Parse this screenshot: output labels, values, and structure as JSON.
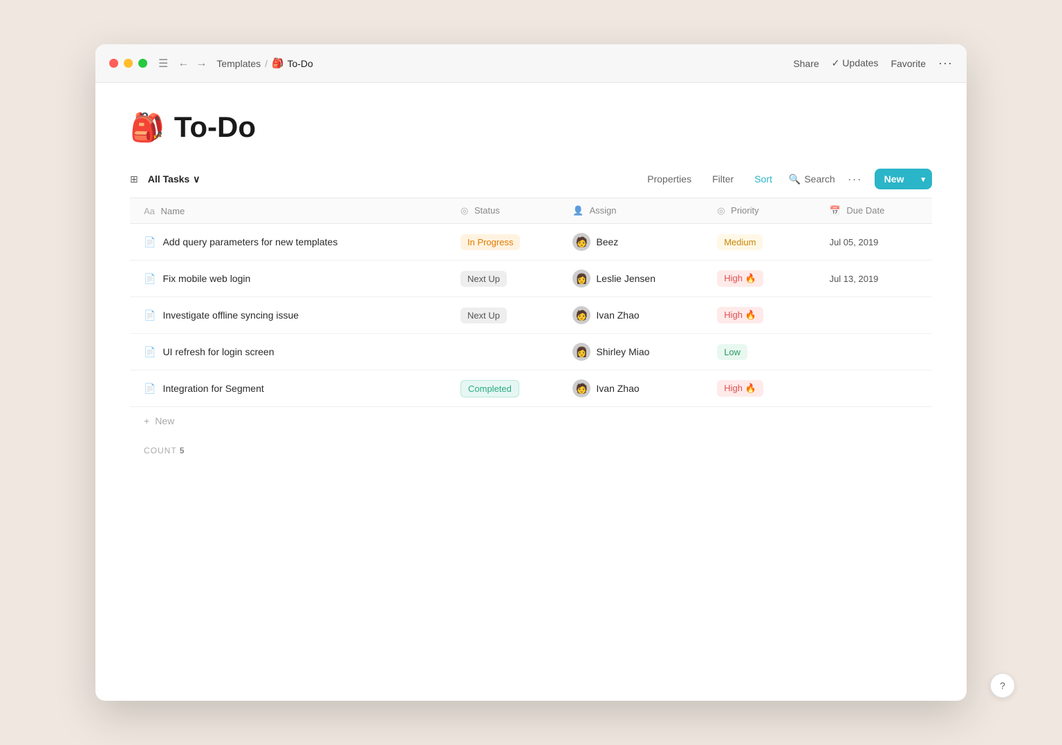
{
  "window": {
    "title": "To-Do",
    "breadcrumb_parent": "Templates",
    "breadcrumb_separator": "/",
    "breadcrumb_icon": "🎒",
    "breadcrumb_current": "To-Do"
  },
  "titlebar": {
    "share_label": "Share",
    "updates_label": "✓ Updates",
    "favorite_label": "Favorite",
    "more_label": "···"
  },
  "page": {
    "icon": "🎒",
    "title": "To-Do"
  },
  "toolbar": {
    "all_tasks_label": "All Tasks",
    "properties_label": "Properties",
    "filter_label": "Filter",
    "sort_label": "Sort",
    "search_label": "Search",
    "new_label": "New"
  },
  "columns": {
    "name": "Name",
    "status": "Status",
    "assign": "Assign",
    "priority": "Priority",
    "due_date": "Due Date"
  },
  "tasks": [
    {
      "id": 1,
      "name": "Add query parameters for new templates",
      "status": "In Progress",
      "status_type": "in-progress",
      "assign": "Beez",
      "assign_avatar": "🧑",
      "priority": "Medium",
      "priority_type": "medium",
      "due_date": "Jul 05, 2019"
    },
    {
      "id": 2,
      "name": "Fix mobile web login",
      "status": "Next Up",
      "status_type": "next-up",
      "assign": "Leslie Jensen",
      "assign_avatar": "👩",
      "priority": "High 🔥",
      "priority_type": "high",
      "due_date": "Jul 13, 2019"
    },
    {
      "id": 3,
      "name": "Investigate offline syncing issue",
      "status": "Next Up",
      "status_type": "next-up",
      "assign": "Ivan Zhao",
      "assign_avatar": "🧑",
      "priority": "High 🔥",
      "priority_type": "high",
      "due_date": ""
    },
    {
      "id": 4,
      "name": "UI refresh for login screen",
      "status": "",
      "status_type": "none",
      "assign": "Shirley Miao",
      "assign_avatar": "👩",
      "priority": "Low",
      "priority_type": "low",
      "due_date": ""
    },
    {
      "id": 5,
      "name": "Integration for Segment",
      "status": "Completed",
      "status_type": "completed",
      "assign": "Ivan Zhao",
      "assign_avatar": "🧑",
      "priority": "High 🔥",
      "priority_type": "high",
      "due_date": ""
    }
  ],
  "footer": {
    "count_label": "COUNT",
    "count_value": "5",
    "add_new_label": "New",
    "help_label": "?"
  }
}
